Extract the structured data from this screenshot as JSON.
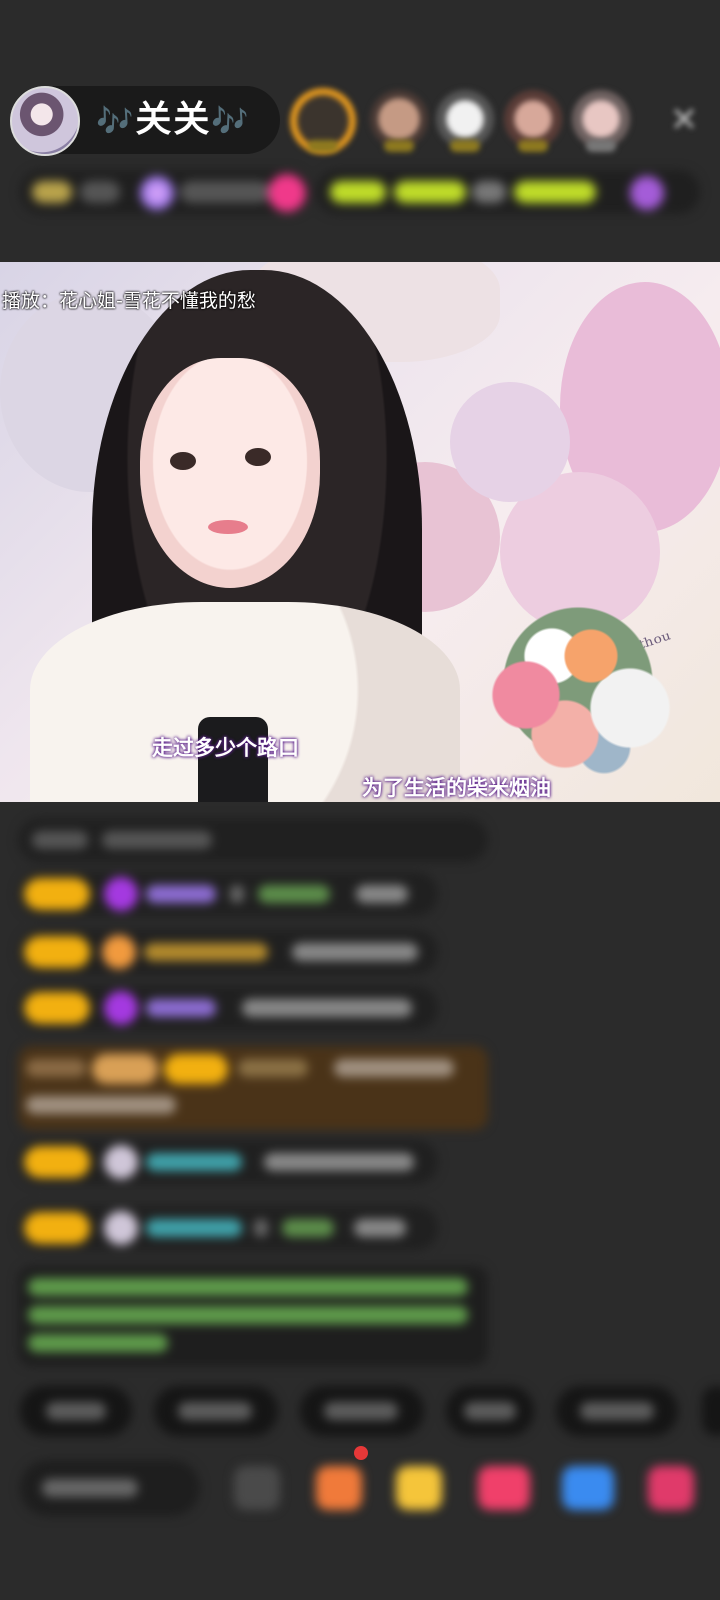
{
  "header": {
    "host_name": "关关",
    "note_left": "🎶",
    "note_right": "🎶",
    "close_icon": "close-icon"
  },
  "video": {
    "now_playing": "播放：花心姐-雪花不懂我的愁",
    "lyric_1": "走过多少个路口",
    "lyric_2": "为了生活的柴米烟油"
  },
  "colors": {
    "badge_gold": "#f2b010",
    "special_row_bg": "#4a3318",
    "chat_bg": "#202020",
    "background": "#2b2b2b"
  }
}
